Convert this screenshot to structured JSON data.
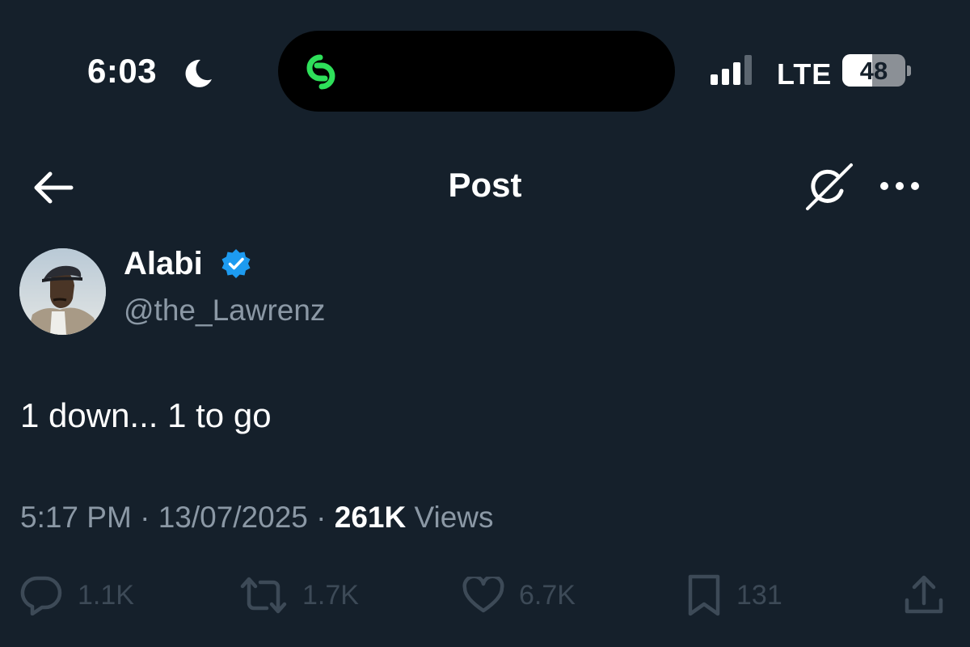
{
  "status_bar": {
    "time": "6:03",
    "network": "LTE",
    "battery": "48",
    "battery_level": 0.48,
    "signal_bars_active": 3,
    "activity_icon": "link-icon",
    "activity_color": "#2ee05a"
  },
  "nav": {
    "title": "Post",
    "back_icon": "arrow-left-icon",
    "grok_icon": "grok-icon",
    "more_icon": "more-horizontal-icon"
  },
  "post": {
    "author_name": "Alabi",
    "author_handle": "@the_Lawrenz",
    "verified": true,
    "verified_color": "#1d9bf0",
    "text": "1 down... 1 to go",
    "time": "5:17 PM",
    "separator": "·",
    "date": "13/07/2025",
    "views_count": "261K",
    "views_label": "Views"
  },
  "actions": {
    "replies": "1.1K",
    "reposts": "1.7K",
    "likes": "6.7K",
    "bookmarks": "131"
  },
  "colors": {
    "background": "#15202b",
    "text_primary": "#ffffff",
    "text_secondary": "#8b98a5",
    "action_dim": "#3d4a57"
  }
}
